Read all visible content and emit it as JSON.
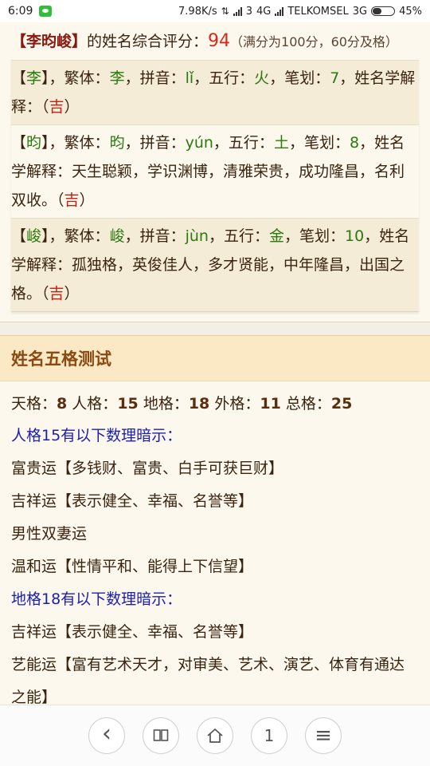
{
  "status_bar": {
    "time": "6:09",
    "net_speed": "7.98K/s",
    "sim1": "3",
    "network1": "4G",
    "carrier": "TELKOMSEL",
    "network2": "3G",
    "battery": "45%",
    "battery_level": 0.45
  },
  "summary": {
    "name_bracket": "【李昀峻】",
    "text": "的姓名综合评分：",
    "score": "94",
    "note": "（满分为100分，60分及格）"
  },
  "characters": [
    {
      "char": "李",
      "trad": "李",
      "pinyin": "lǐ",
      "element": "火",
      "strokes": "7",
      "explanation": "",
      "luck": "吉"
    },
    {
      "char": "昀",
      "trad": "昀",
      "pinyin": "yún",
      "element": "土",
      "strokes": "8",
      "explanation": "天生聪颖，学识渊博，清雅荣贵，成功隆昌，名利双收。",
      "luck": "吉"
    },
    {
      "char": "峻",
      "trad": "峻",
      "pinyin": "jùn",
      "element": "金",
      "strokes": "10",
      "explanation": "孤独格，英俊佳人，多才贤能，中年隆昌，出国之格。",
      "luck": "吉"
    }
  ],
  "labels": {
    "trad": "，繁体：",
    "pinyin": "，拼音：",
    "element": "，五行：",
    "strokes": "，笔划：",
    "explain": "，姓名学解释："
  },
  "wuge": {
    "title": "姓名五格测试",
    "tian_label": "天格：",
    "tian": "8",
    "ren_label": "人格：",
    "ren": "15",
    "di_label": "地格：",
    "di": "18",
    "wai_label": "外格：",
    "wai": "11",
    "zong_label": "总格：",
    "zong": "25",
    "ren_hint_title": "人格15有以下数理暗示：",
    "ren_hints": [
      "富贵运【多钱财、富贵、白手可获巨财】",
      "吉祥运【表示健全、幸福、名誉等】",
      "男性双妻运",
      "温和运【性情平和、能得上下信望】"
    ],
    "di_hint_title": "地格18有以下数理暗示：",
    "di_hints": [
      "吉祥运【表示健全、幸福、名誉等】",
      "艺能运【富有艺术天才，对审美、艺术、演艺、体育有通达之能】"
    ]
  },
  "bottom_bar": {
    "back_icon": "‹",
    "book_icon": "▯▯",
    "home_icon": "⌂",
    "tabs_count": "1",
    "menu_icon": "≡"
  }
}
